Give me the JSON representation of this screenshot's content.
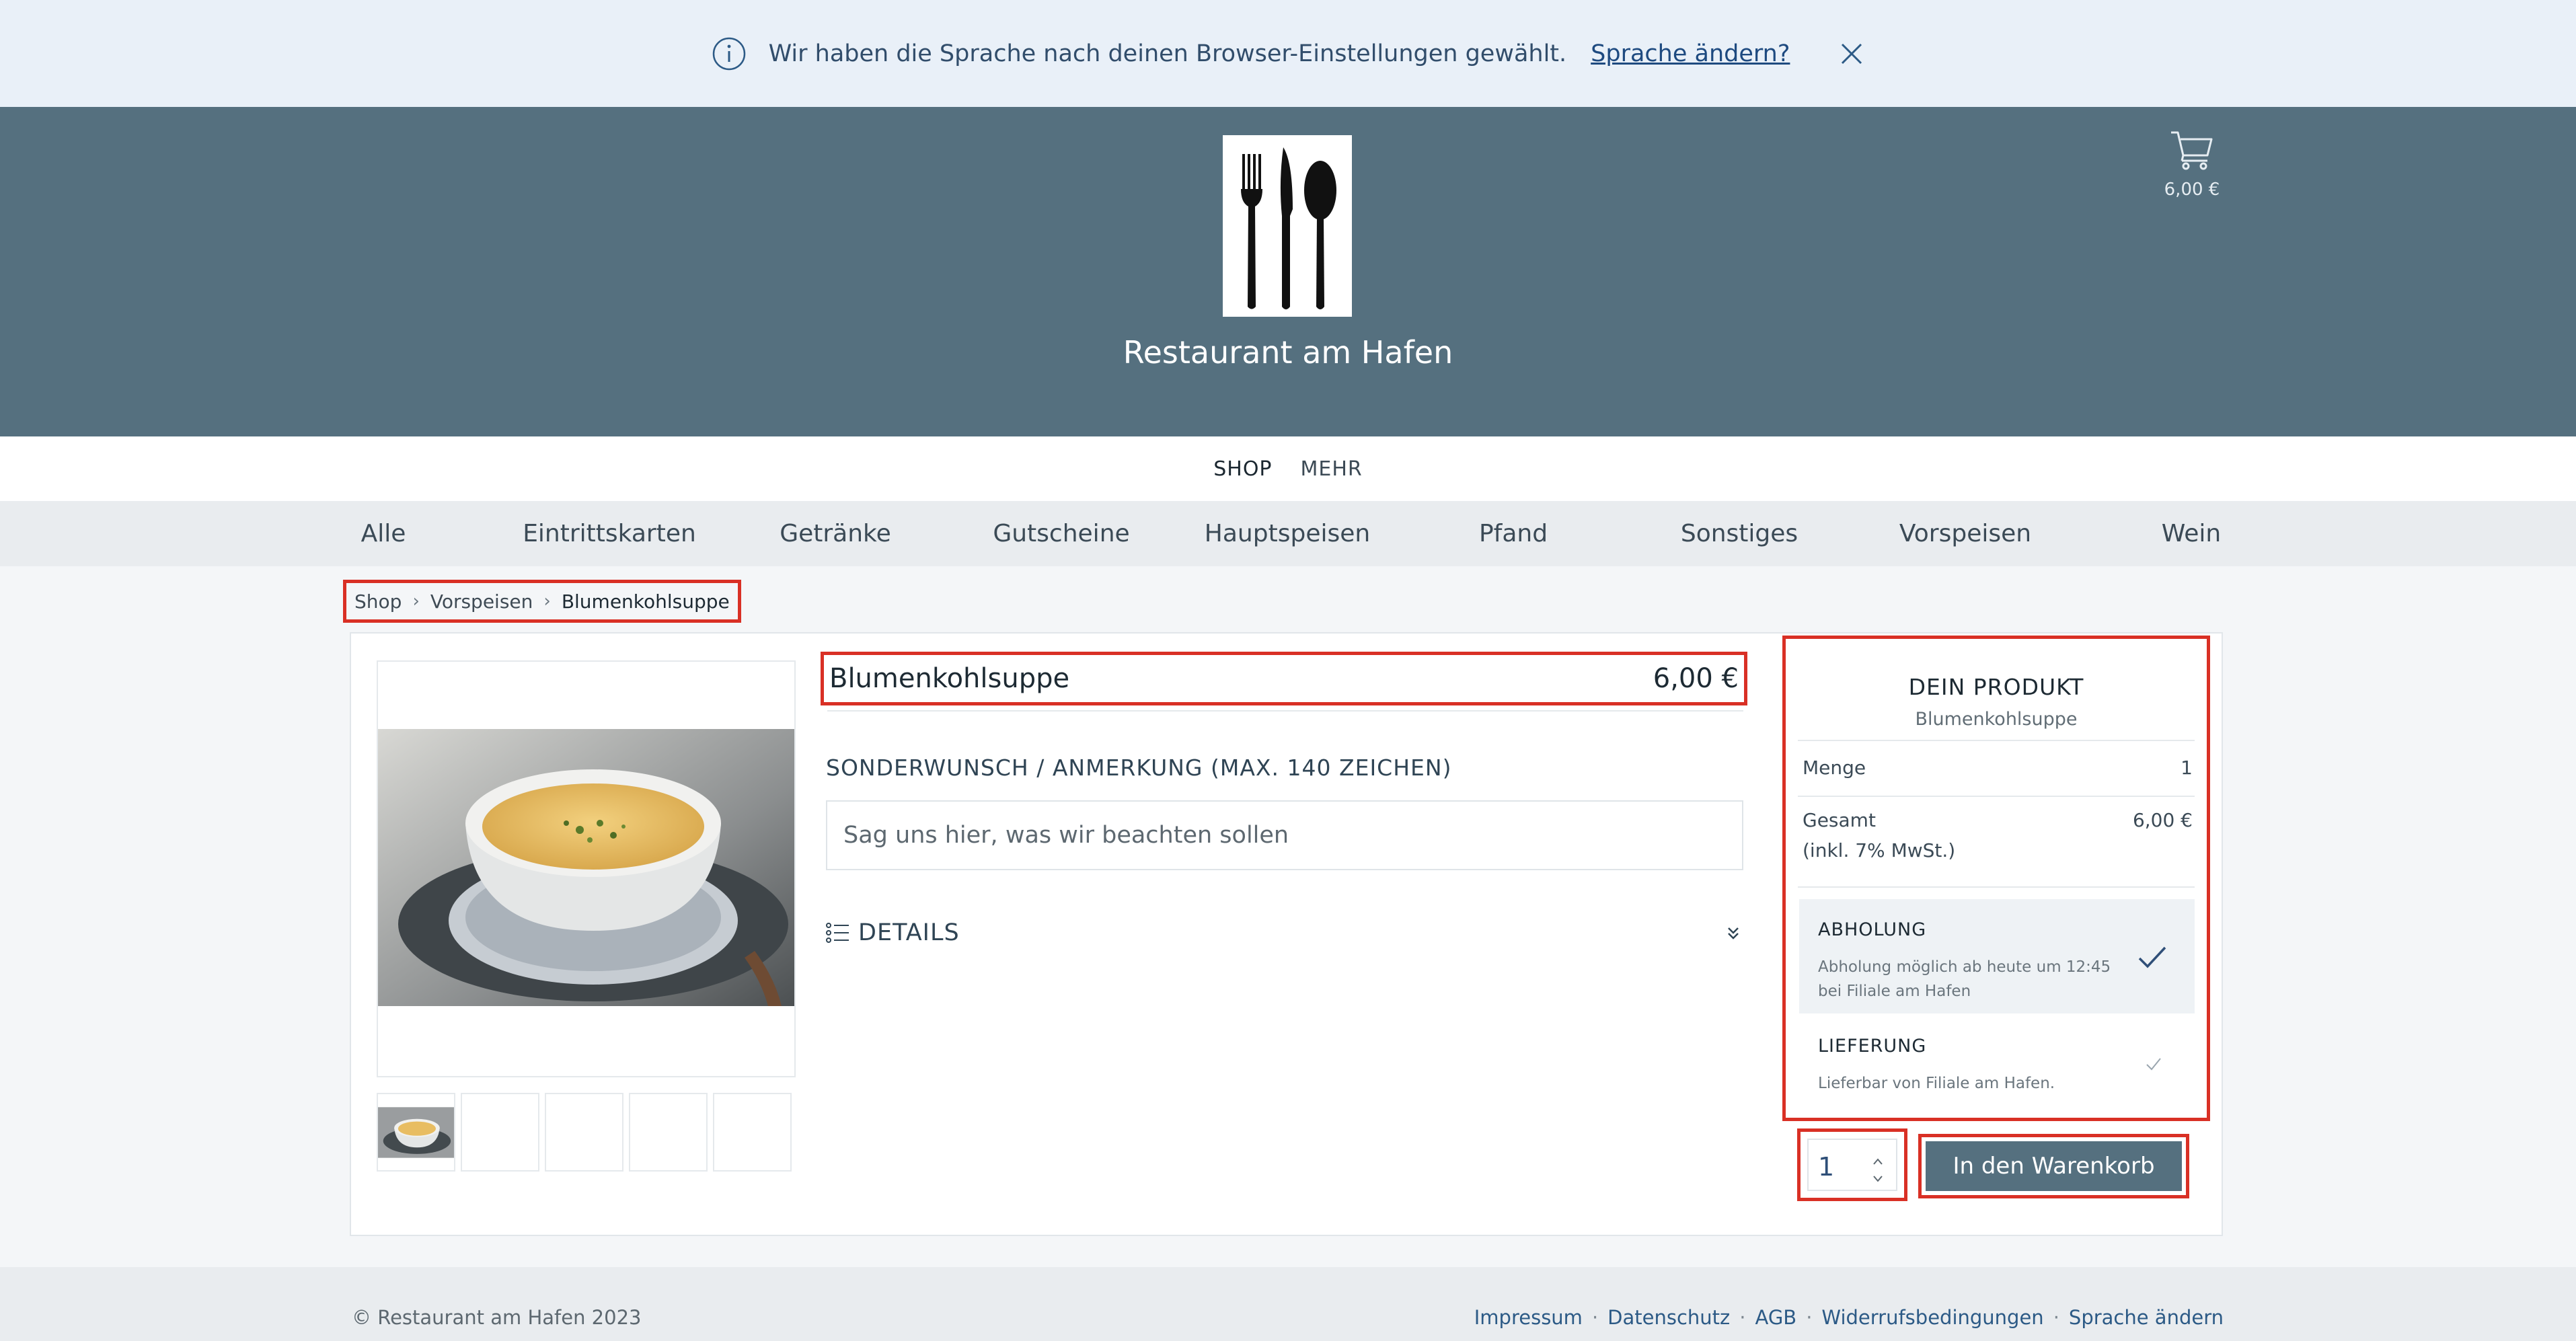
{
  "notice": {
    "text": "Wir haben die Sprache nach deinen Browser-Einstellungen gewählt.",
    "link": "Sprache ändern?"
  },
  "header": {
    "restaurant_name": "Restaurant am Hafen",
    "cart_total": "6,00 €"
  },
  "topnav": {
    "shop": "SHOP",
    "more": "MEHR"
  },
  "categories": [
    "Alle",
    "Eintrittskarten",
    "Getränke",
    "Gutscheine",
    "Hauptspeisen",
    "Pfand",
    "Sonstiges",
    "Vorspeisen",
    "Wein"
  ],
  "breadcrumb": {
    "home": "Shop",
    "category": "Vorspeisen",
    "current": "Blumenkohlsuppe",
    "separator": "›"
  },
  "product": {
    "name": "Blumenkohlsuppe",
    "price": "6,00 €",
    "remark_label": "SONDERWUNSCH / ANMERKUNG (MAX. 140 ZEICHEN)",
    "remark_placeholder": "Sag uns hier, was wir beachten sollen",
    "details_label": "DETAILS"
  },
  "summary": {
    "title": "DEIN PRODUKT",
    "product_name": "Blumenkohlsuppe",
    "quantity_label": "Menge",
    "quantity_value": "1",
    "total_label": "Gesamt",
    "total_value": "6,00 €",
    "total_note": "(inkl. 7% MwSt.)",
    "options": [
      {
        "title": "ABHOLUNG",
        "desc": "Abholung möglich ab heute um 12:45 bei Filiale am Hafen",
        "selected": true
      },
      {
        "title": "LIEFERUNG",
        "desc": "Lieferbar von Filiale am Hafen.",
        "selected": false
      }
    ]
  },
  "order": {
    "quantity": "1",
    "add_to_cart": "In den Warenkorb"
  },
  "footer": {
    "copyright": "© Restaurant am Hafen 2023",
    "links": [
      "Impressum",
      "Datenschutz",
      "AGB",
      "Widerrufsbedingungen",
      "Sprache ändern"
    ],
    "separator": "·"
  },
  "colors": {
    "header_bg": "#55707f",
    "notice_bg": "#e9f0f8",
    "highlight": "#d93025",
    "link": "#2c5a86"
  }
}
